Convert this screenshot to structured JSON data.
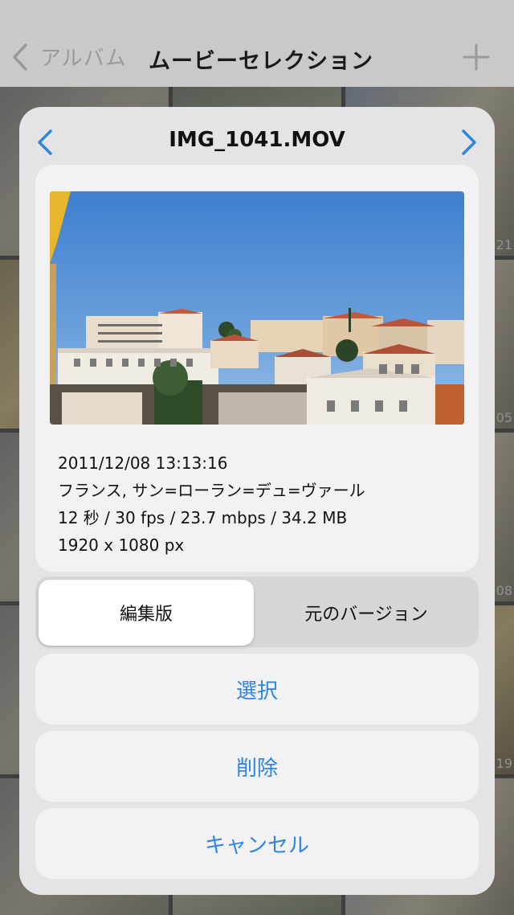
{
  "navbar": {
    "back_label": "アルバム",
    "title": "ムービーセレクション"
  },
  "background_thumbnails": {
    "numbers": [
      "21",
      "05",
      "08",
      "19"
    ]
  },
  "sheet": {
    "title": "IMG_1041.MOV",
    "info": {
      "datetime": "2011/12/08 13:13:16",
      "location": "フランス, サン=ローラン=デュ=ヴァール",
      "specs": "12 秒 / 30 fps / 23.7 mbps / 34.2 MB",
      "resolution": "1920 x 1080 px"
    },
    "version_toggle": {
      "selected": "編集版",
      "other": "元のバージョン"
    },
    "actions": {
      "select": "選択",
      "delete": "削除",
      "cancel": "キャンセル"
    }
  },
  "colors": {
    "accent": "#2e86e0",
    "navbar_bg": "#c9c9c9",
    "sheet_bg": "#e4e4e7",
    "card_bg": "#f2f2f4"
  }
}
